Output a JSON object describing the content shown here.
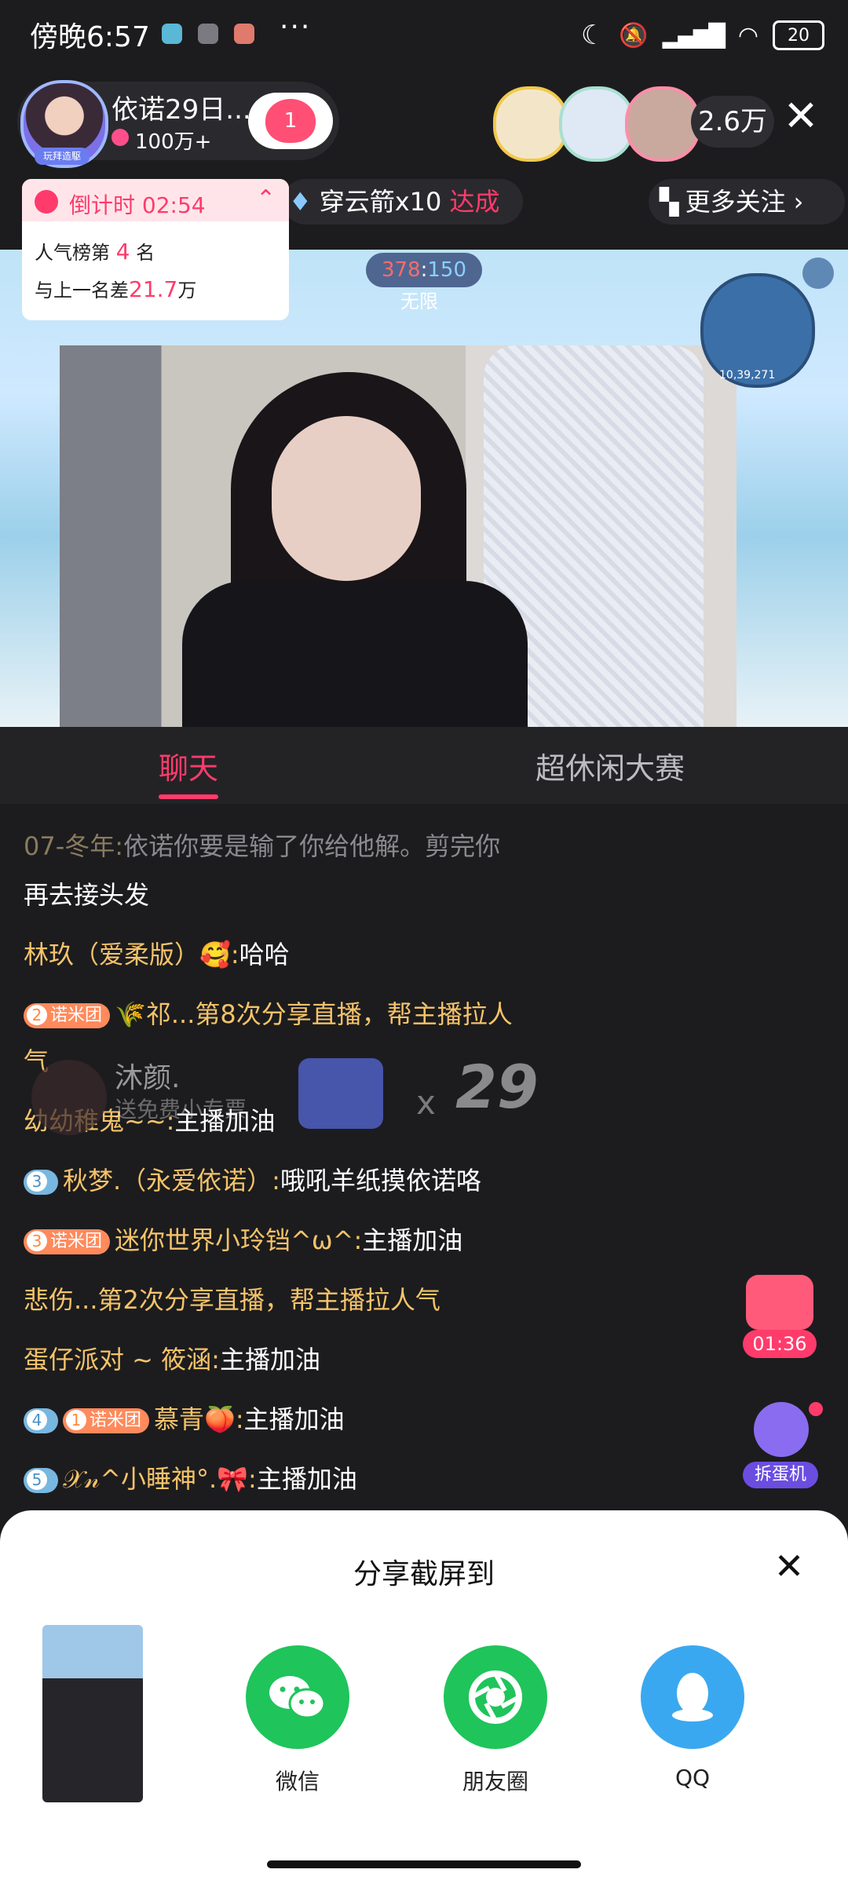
{
  "status_bar": {
    "time": "傍晚6:57",
    "more": "···",
    "battery": "20"
  },
  "header": {
    "anchor_name": "依诺29日...",
    "anchor_badge": "玩拜造駆",
    "followers": "100万+",
    "follow_count": "1",
    "viewer_count": "2.6万"
  },
  "row2": {
    "gift_task": "穿云箭x10 ",
    "gift_task_status": "达成",
    "more_follow": "更多关注"
  },
  "popup": {
    "countdown": "倒计时 02:54",
    "rank_prefix": "人气榜第",
    "rank_value": "4",
    "rank_suffix": "名",
    "gap_prefix": "与上一名差",
    "gap_value": "21.7",
    "gap_suffix": "万"
  },
  "video": {
    "score_left": "378",
    "score_right": "150",
    "score_sep": ":",
    "mode": "无限",
    "map_label": "10,39,271"
  },
  "tabs": {
    "chat": "聊天",
    "contest": "超休闲大赛"
  },
  "chat": [
    {
      "nick": "07-冬年:",
      "text": "依诺你要是输了你给他解。剪完你"
    },
    {
      "text": "再去接头发"
    },
    {
      "nick": "林玖（爱柔版）🥰:",
      "text": "哈哈"
    },
    {
      "badge_num": "2",
      "badge_label": "诺米团",
      "text": "🌾祁...第8次分享直播，帮主播拉人"
    },
    {
      "text": "气"
    },
    {
      "nick": "幼幼稚鬼~~:",
      "text": "主播加油"
    },
    {
      "badge_num": "3",
      "nick": "秋梦.（永爱依诺）:",
      "text": "哦吼羊纸摸依诺咯"
    },
    {
      "badge_num": "3",
      "badge_label": "诺米团",
      "nick": "迷你世界小玲铛^ω^:",
      "text": "主播加油"
    },
    {
      "text": "悲伤...第2次分享直播，帮主播拉人气"
    },
    {
      "nick": "蛋仔派对 ~ 筱涵:",
      "text": "主播加油"
    },
    {
      "badge_num": "4",
      "badge2_num": "1",
      "badge_label": "诺米团",
      "nick": "慕青🍑:",
      "text": "主播加油"
    },
    {
      "badge_num": "5",
      "nick": "𝒳𝓃^小睡神°.🎀:",
      "text": "主播加油"
    }
  ],
  "gift_overlay": {
    "sender": "沐颜.",
    "desc": "送免费小专票",
    "times": "x",
    "count": "29"
  },
  "side": {
    "chest_timer": "01:36",
    "hammer_label": "拆蛋机"
  },
  "share": {
    "title": "分享截屏到",
    "items": [
      {
        "label": "微信",
        "color": "#1fc45a",
        "icon": "wechat-icon"
      },
      {
        "label": "朋友圈",
        "color": "#1fc45a",
        "icon": "moments-icon"
      },
      {
        "label": "QQ",
        "color": "#3aa8f0",
        "icon": "qq-icon"
      }
    ]
  },
  "colors": {
    "accent": "#ff3b6b",
    "nick": "#f5c36a",
    "bg": "#1c1c1e"
  }
}
